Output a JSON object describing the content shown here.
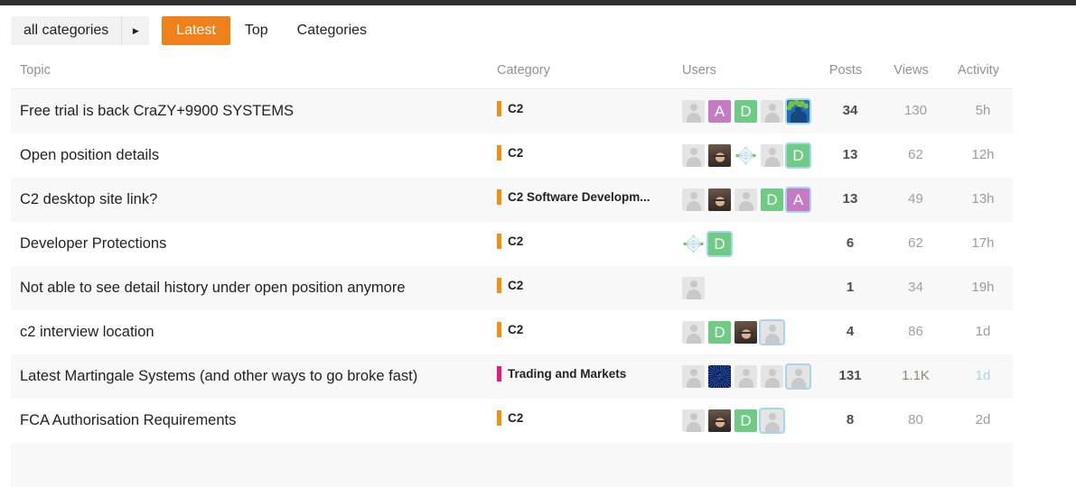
{
  "nav": {
    "category_selector": {
      "label": "all categories",
      "caret": "chevron-right-icon"
    },
    "links": [
      {
        "label": "Latest",
        "active": true
      },
      {
        "label": "Top",
        "active": false
      },
      {
        "label": "Categories",
        "active": false
      }
    ]
  },
  "table": {
    "headers": {
      "topic": "Topic",
      "category": "Category",
      "users": "Users",
      "posts": "Posts",
      "views": "Views",
      "activity": "Activity"
    },
    "rows": [
      {
        "title": "Free trial is back CraZY+9900 SYSTEMS",
        "category": {
          "name": "C2",
          "color": "#f0900f"
        },
        "users": [
          {
            "type": "default"
          },
          {
            "type": "letter",
            "letter": "A",
            "bg": "#c57bc4"
          },
          {
            "type": "letter",
            "letter": "D",
            "bg": "#6dcb84"
          },
          {
            "type": "default"
          },
          {
            "type": "confetti",
            "latest": true
          }
        ],
        "posts": "34",
        "views": "130",
        "activity": "5h"
      },
      {
        "title": "Open position details",
        "category": {
          "name": "C2",
          "color": "#f0900f"
        },
        "users": [
          {
            "type": "default"
          },
          {
            "type": "photo"
          },
          {
            "type": "neuralnet"
          },
          {
            "type": "default"
          },
          {
            "type": "letter",
            "letter": "D",
            "bg": "#6dcb84",
            "latest": true
          }
        ],
        "posts": "13",
        "views": "62",
        "activity": "12h"
      },
      {
        "title": "C2 desktop site link?",
        "category": {
          "name": "C2 Software Developm...",
          "color": "#f0900f"
        },
        "users": [
          {
            "type": "default"
          },
          {
            "type": "photo"
          },
          {
            "type": "default"
          },
          {
            "type": "letter",
            "letter": "D",
            "bg": "#6dcb84"
          },
          {
            "type": "letter",
            "letter": "A",
            "bg": "#c57bc4",
            "latest": true
          }
        ],
        "posts": "13",
        "views": "49",
        "activity": "13h"
      },
      {
        "title": "Developer Protections",
        "category": {
          "name": "C2",
          "color": "#f0900f"
        },
        "users": [
          {
            "type": "neuralnet"
          },
          {
            "type": "letter",
            "letter": "D",
            "bg": "#6dcb84",
            "latest": true
          }
        ],
        "posts": "6",
        "views": "62",
        "activity": "17h"
      },
      {
        "title": "Not able to see detail history under open position anymore",
        "category": {
          "name": "C2",
          "color": "#f0900f"
        },
        "users": [
          {
            "type": "default"
          }
        ],
        "posts": "1",
        "views": "34",
        "activity": "19h"
      },
      {
        "title": "c2 interview location",
        "category": {
          "name": "C2",
          "color": "#f0900f"
        },
        "users": [
          {
            "type": "default"
          },
          {
            "type": "letter",
            "letter": "D",
            "bg": "#6dcb84"
          },
          {
            "type": "photo"
          },
          {
            "type": "default",
            "latest": true
          }
        ],
        "posts": "4",
        "views": "86",
        "activity": "1d"
      },
      {
        "title": "Latest Martingale Systems (and other ways to go broke fast)",
        "category": {
          "name": "Trading and Markets",
          "color": "#e8197d"
        },
        "users": [
          {
            "type": "default"
          },
          {
            "type": "starburst"
          },
          {
            "type": "default"
          },
          {
            "type": "default"
          },
          {
            "type": "default",
            "latest": true
          }
        ],
        "posts": "131",
        "views": "1.1K",
        "views_hot": true,
        "activity": "1d",
        "activity_recent": true
      },
      {
        "title": "FCA Authorisation Requirements",
        "category": {
          "name": "C2",
          "color": "#f0900f"
        },
        "users": [
          {
            "type": "default"
          },
          {
            "type": "photo"
          },
          {
            "type": "letter",
            "letter": "D",
            "bg": "#6dcb84"
          },
          {
            "type": "default",
            "latest": true
          }
        ],
        "posts": "8",
        "views": "80",
        "activity": "2d"
      }
    ]
  },
  "colors": {
    "accent": "#f08019",
    "category_c2": "#f0900f",
    "category_trading": "#e8197d",
    "avatar_green": "#6dcb84",
    "avatar_purple": "#c57bc4",
    "latest_poster_ring": "#a6d5f0"
  }
}
